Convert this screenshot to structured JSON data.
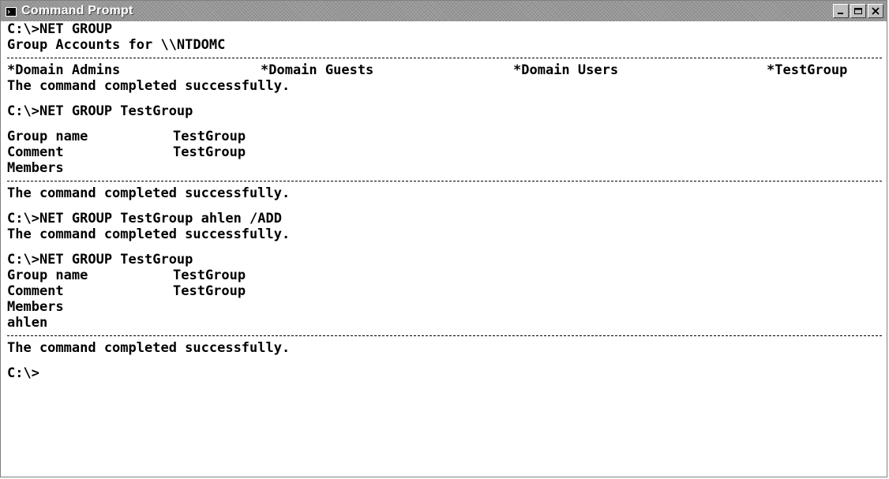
{
  "window": {
    "title": "Command Prompt",
    "icon": "console-icon",
    "buttons": [
      "minimize-icon",
      "maximize-icon",
      "close-icon"
    ]
  },
  "console": {
    "lines": {
      "l1": "C:\\>NET GROUP",
      "l2": "Group Accounts for \\\\NTDOMC",
      "groups": [
        "*Domain Admins",
        "*Domain Guests",
        "*Domain Users",
        "*TestGroup"
      ],
      "l4": "The command completed successfully.",
      "l5": "C:\\>NET GROUP TestGroup",
      "gn_label": "Group name",
      "gn_value": "TestGroup",
      "cm_label": "Comment",
      "cm_value": "TestGroup",
      "members_label": "Members",
      "l9": "The command completed successfully.",
      "l10": "C:\\>NET GROUP TestGroup ahlen /ADD",
      "l11": "The command completed successfully.",
      "l12": "C:\\>NET GROUP TestGroup",
      "gn2_label": "Group name",
      "gn2_value": "TestGroup",
      "cm2_label": "Comment",
      "cm2_value": "TestGroup",
      "members2_label": "Members",
      "member1": "ahlen",
      "l18": "The command completed successfully.",
      "prompt": "C:\\>"
    }
  }
}
